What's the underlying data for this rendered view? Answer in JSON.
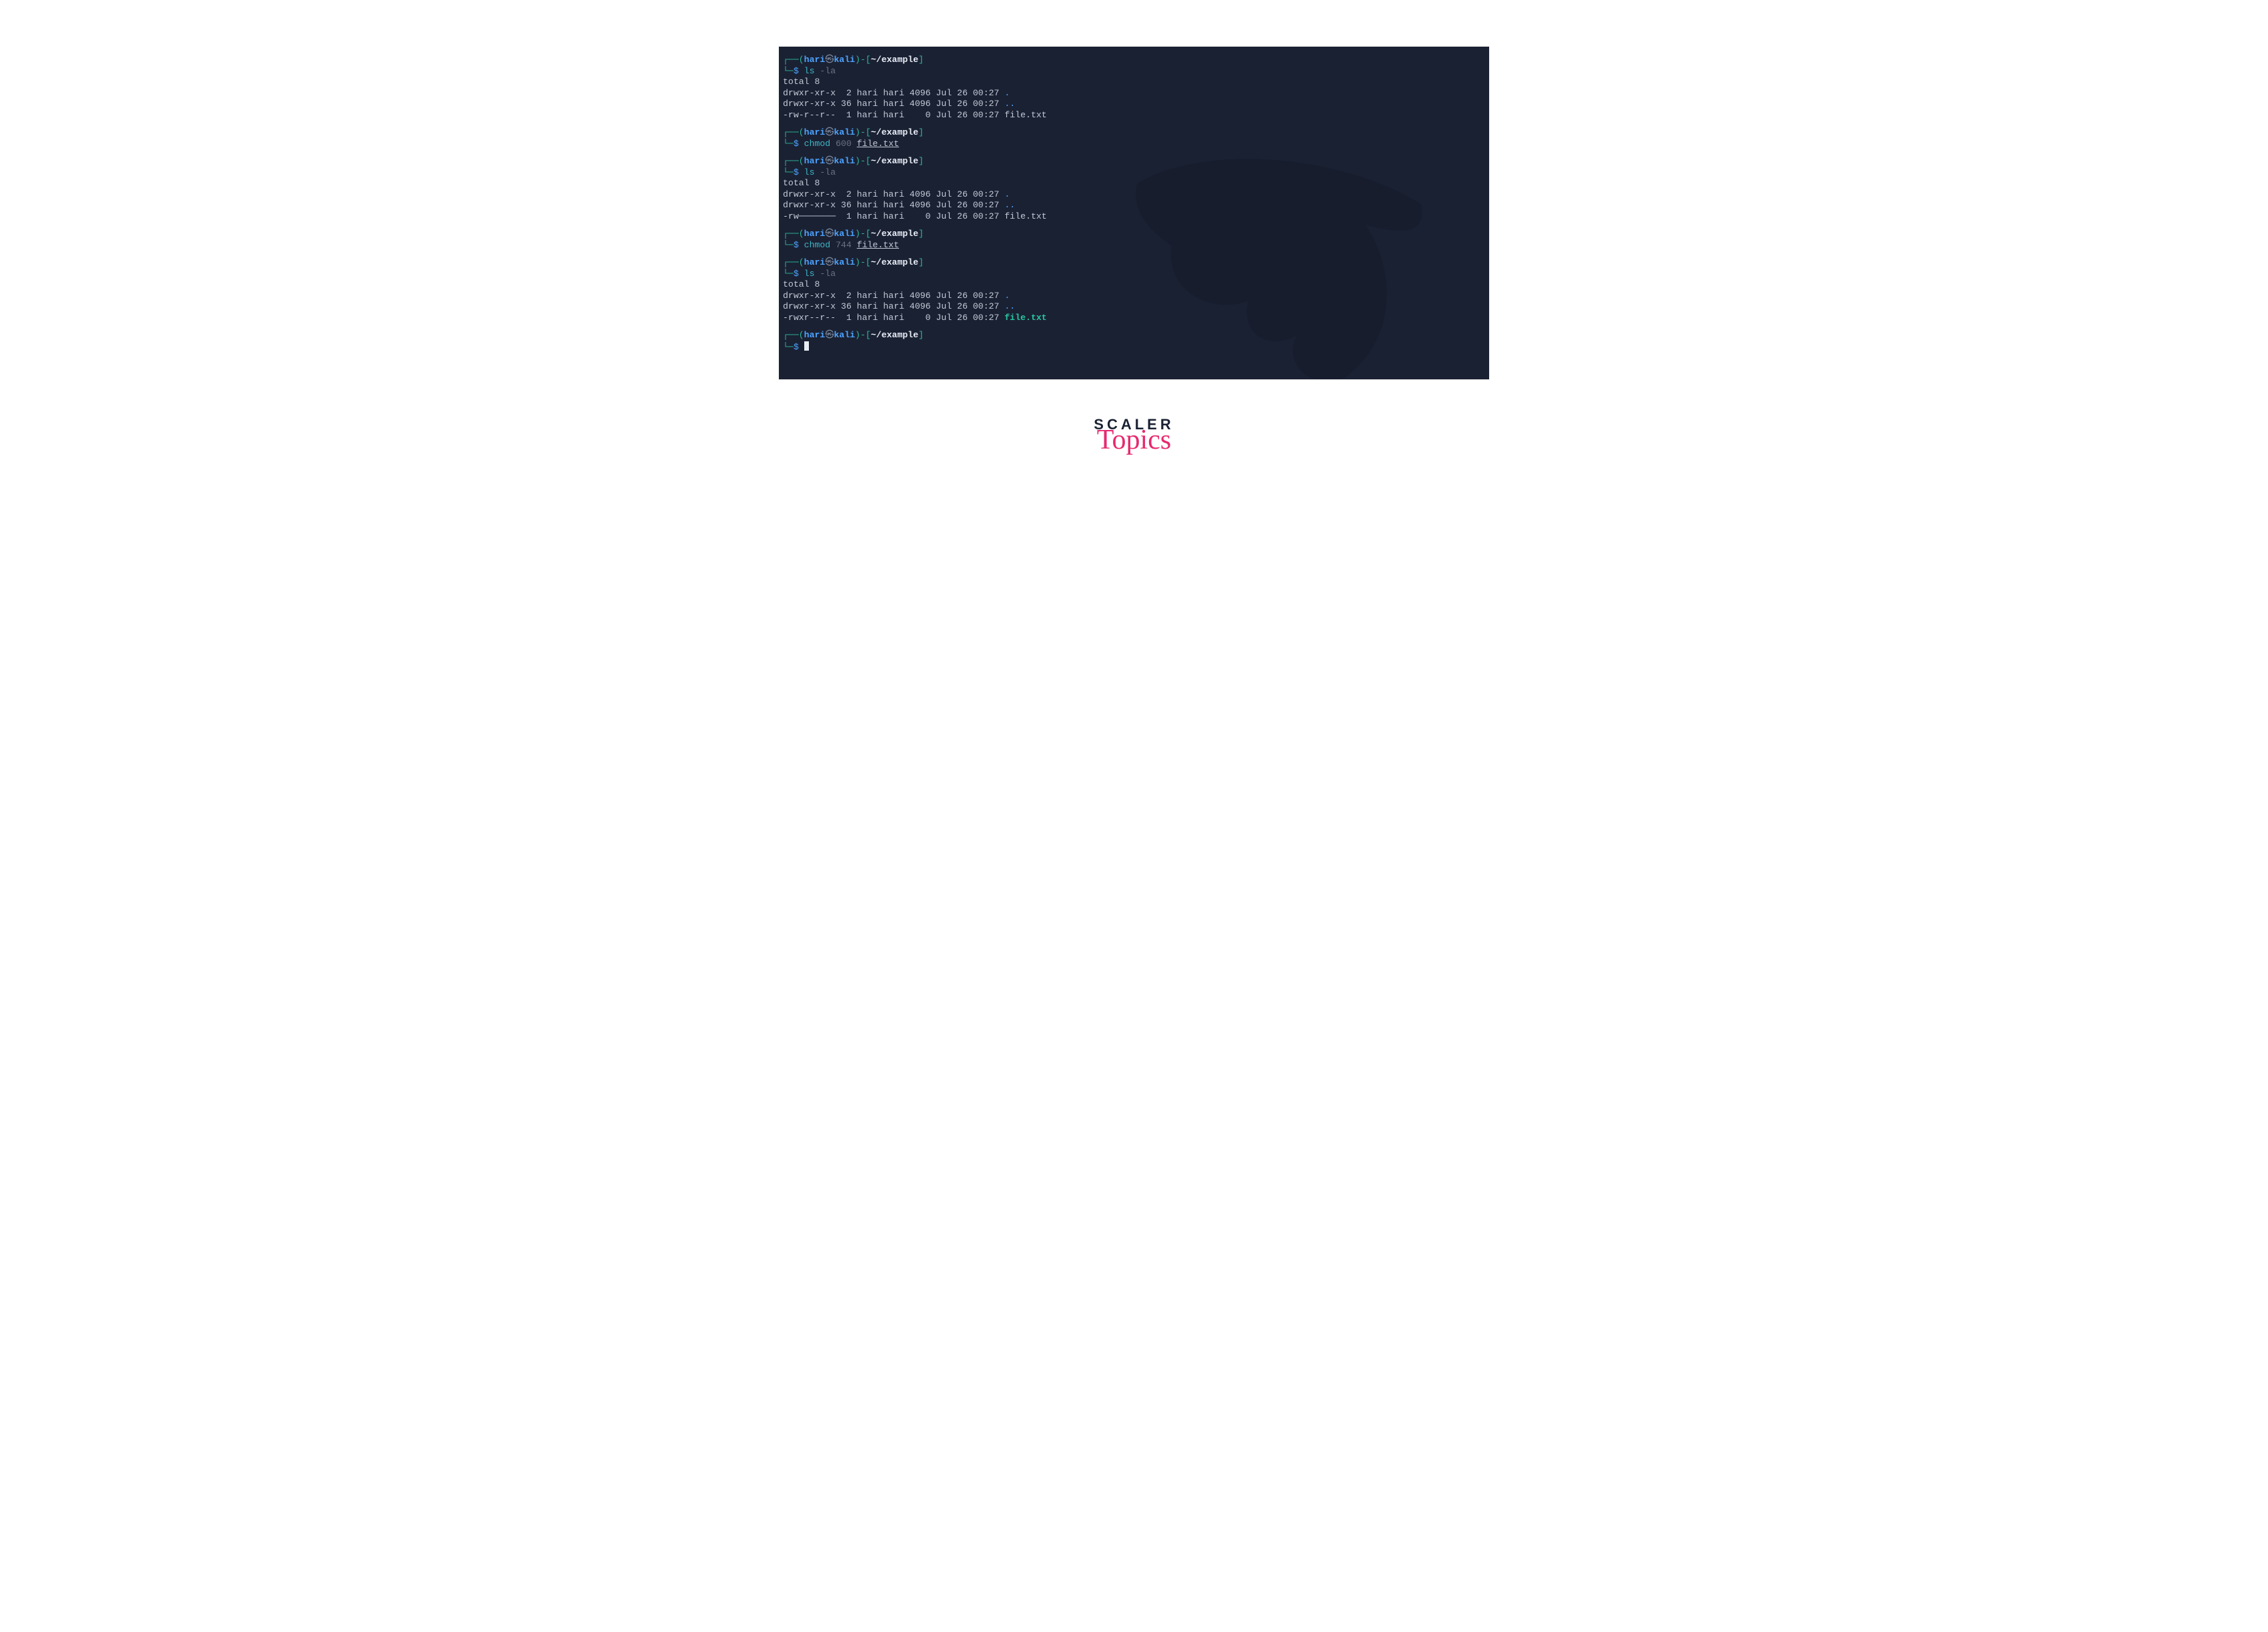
{
  "prompt": {
    "open1": "┌──(",
    "user": "hari",
    "at": "㉿",
    "host": "kali",
    "close1": ")-[",
    "path": "~/example",
    "close2": "]",
    "line2": "└─",
    "sigil": "$ "
  },
  "blocks": [
    {
      "cmd": {
        "bin": "ls",
        "args": " -la"
      },
      "out": [
        [
          {
            "t": "total 8",
            "c": "plain"
          }
        ],
        [
          {
            "t": "drwxr-xr-x  2 hari hari 4096 Jul 26 00:27 ",
            "c": "plain"
          },
          {
            "t": ".",
            "c": "blue"
          }
        ],
        [
          {
            "t": "drwxr-xr-x 36 hari hari 4096 Jul 26 00:27 ",
            "c": "plain"
          },
          {
            "t": "..",
            "c": "blue"
          }
        ],
        [
          {
            "t": "-rw-r--r--  1 hari hari    0 Jul 26 00:27 file.txt",
            "c": "plain"
          }
        ]
      ]
    },
    {
      "cmd": {
        "bin": "chmod",
        "args": " 600 ",
        "tail_underline": "file.txt"
      },
      "out": []
    },
    {
      "cmd": {
        "bin": "ls",
        "args": " -la"
      },
      "out": [
        [
          {
            "t": "total 8",
            "c": "plain"
          }
        ],
        [
          {
            "t": "drwxr-xr-x  2 hari hari 4096 Jul 26 00:27 ",
            "c": "plain"
          },
          {
            "t": ".",
            "c": "blue"
          }
        ],
        [
          {
            "t": "drwxr-xr-x 36 hari hari 4096 Jul 26 00:27 ",
            "c": "plain"
          },
          {
            "t": "..",
            "c": "blue"
          }
        ],
        [
          {
            "t": "-rw───────  1 hari hari    0 Jul 26 00:27 file.txt",
            "c": "plain"
          }
        ]
      ]
    },
    {
      "cmd": {
        "bin": "chmod",
        "args": " 744 ",
        "tail_underline": "file.txt"
      },
      "out": []
    },
    {
      "cmd": {
        "bin": "ls",
        "args": " -la"
      },
      "out": [
        [
          {
            "t": "total 8",
            "c": "plain"
          }
        ],
        [
          {
            "t": "drwxr-xr-x  2 hari hari 4096 Jul 26 00:27 ",
            "c": "plain"
          },
          {
            "t": ".",
            "c": "blue"
          }
        ],
        [
          {
            "t": "drwxr-xr-x 36 hari hari 4096 Jul 26 00:27 ",
            "c": "plain"
          },
          {
            "t": "..",
            "c": "blue"
          }
        ],
        [
          {
            "t": "-rwxr--r--  1 hari hari    0 Jul 26 00:27 ",
            "c": "plain"
          },
          {
            "t": "file.txt",
            "c": "greenfile"
          }
        ]
      ]
    },
    {
      "cmd": {
        "cursor": true
      },
      "out": []
    }
  ],
  "logo": {
    "top": "SCALER",
    "bottom": "Topics"
  }
}
